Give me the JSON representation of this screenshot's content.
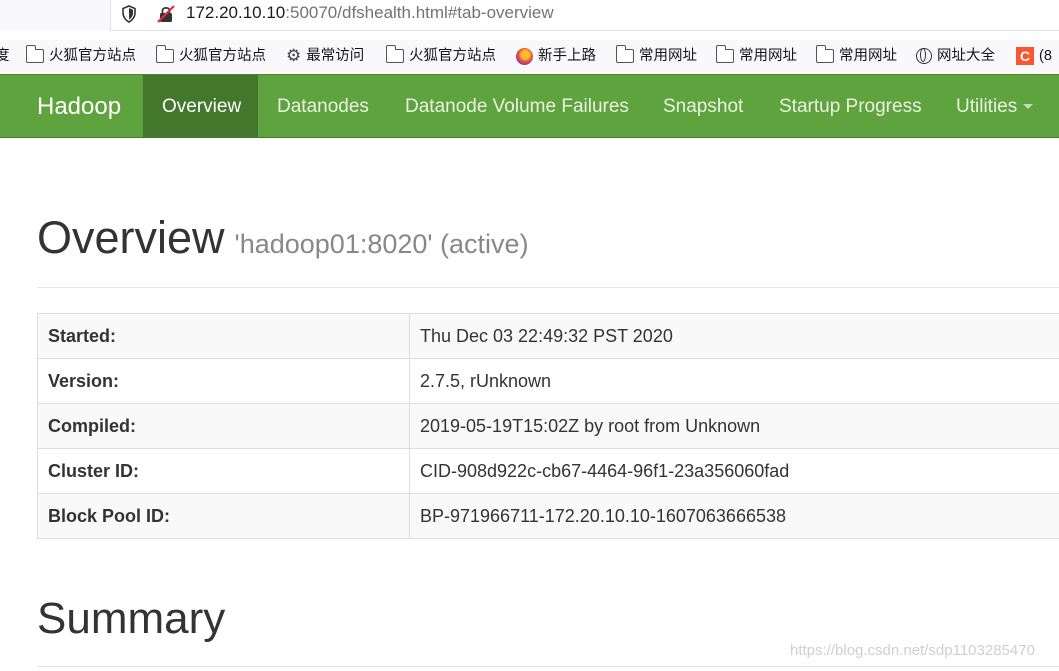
{
  "browser": {
    "url_host": "172.20.10.10",
    "url_rest": ":50070/dfshealth.html#tab-overview",
    "bookmarks": [
      {
        "icon": "partial-text",
        "label": "度"
      },
      {
        "icon": "folder-icon",
        "label": "火狐官方站点"
      },
      {
        "icon": "folder-icon",
        "label": "火狐官方站点"
      },
      {
        "icon": "gear-icon",
        "label": "最常访问"
      },
      {
        "icon": "folder-icon",
        "label": "火狐官方站点"
      },
      {
        "icon": "firefox-icon",
        "label": "新手上路"
      },
      {
        "icon": "folder-icon",
        "label": "常用网址"
      },
      {
        "icon": "folder-icon",
        "label": "常用网址"
      },
      {
        "icon": "folder-icon",
        "label": "常用网址"
      },
      {
        "icon": "globe-icon",
        "label": "网址大全"
      },
      {
        "icon": "csdn-icon",
        "label": "C"
      },
      {
        "icon": "partial-text",
        "label": "(8"
      }
    ]
  },
  "navbar": {
    "brand": "Hadoop",
    "items": [
      "Overview",
      "Datanodes",
      "Datanode Volume Failures",
      "Snapshot",
      "Startup Progress",
      "Utilities"
    ],
    "active": "Overview",
    "brand_color": "#5fa33e",
    "active_color": "#42772c"
  },
  "overview": {
    "title": "Overview",
    "subtitle": "'hadoop01:8020' (active)",
    "rows": [
      {
        "key": "Started:",
        "value": "Thu Dec 03 22:49:32 PST 2020"
      },
      {
        "key": "Version:",
        "value": "2.7.5, rUnknown"
      },
      {
        "key": "Compiled:",
        "value": "2019-05-19T15:02Z by root from Unknown"
      },
      {
        "key": "Cluster ID:",
        "value": "CID-908d922c-cb67-4464-96f1-23a356060fad"
      },
      {
        "key": "Block Pool ID:",
        "value": "BP-971966711-172.20.10.10-1607063666538"
      }
    ]
  },
  "summary": {
    "title": "Summary"
  },
  "watermark": "https://blog.csdn.net/sdp1103285470"
}
